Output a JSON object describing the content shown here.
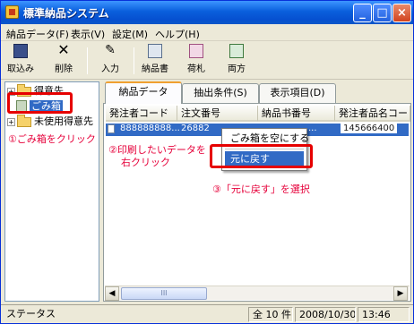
{
  "window": {
    "title": "標準納品システム"
  },
  "menu": [
    "納品データ(F)",
    "表示(V)",
    "設定(M)",
    "ヘルプ(H)"
  ],
  "toolbar": {
    "import": "取込み",
    "delete": "削除",
    "input": "入力",
    "invoice": "納品書",
    "tag": "荷札",
    "both": "両方"
  },
  "tree": {
    "item1": "得意先",
    "item2": "ごみ箱",
    "item3": "未使用得意先"
  },
  "annotations": {
    "step1": "①ごみ箱をクリック",
    "step2_line1": "②印刷したいデータを",
    "step2_line2": "右クリック",
    "step3": "③「元に戻す」を選択"
  },
  "tabs": [
    "納品データ",
    "抽出条件(S)",
    "表示項目(D)"
  ],
  "columns": [
    "発注者コード",
    "注文番号",
    "納品书番号",
    "発注者品名コード"
  ],
  "row": {
    "col1": "888888888...",
    "col2": "26882",
    "col3": "...",
    "col4": "145666400"
  },
  "context_menu": {
    "empty_trash": "ごみ箱を空にする",
    "restore": "元に戻す"
  },
  "scroll_thumb_grip": "III",
  "status": {
    "label": "ステータス",
    "count": "全 10 件",
    "date": "2008/10/30",
    "time": "13:46"
  }
}
